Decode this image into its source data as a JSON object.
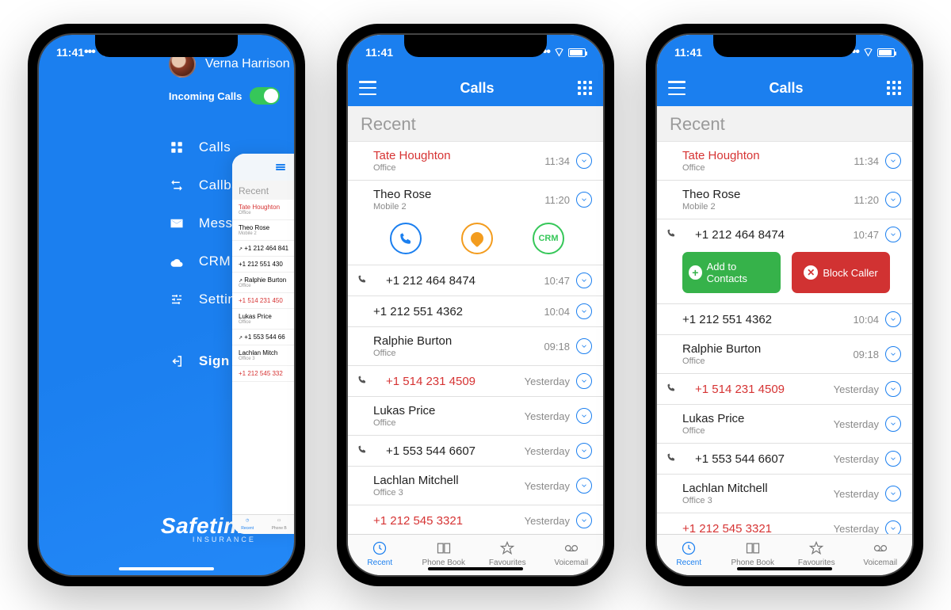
{
  "status": {
    "time": "11:41"
  },
  "screen1": {
    "user_name": "Verna Harrison",
    "incoming_label": "Incoming Calls",
    "menu": {
      "calls": "Calls",
      "callbacks": "Callbacks",
      "messages": "Messages",
      "crm": "CRM",
      "settings": "Settings",
      "signout": "Sign Out"
    },
    "brand": {
      "name": "Safetime",
      "sub": "INSURANCE"
    },
    "preview": {
      "section": "Recent",
      "items": [
        {
          "name": "Tate Houghton",
          "sub": "Office",
          "red": true
        },
        {
          "name": "Theo Rose",
          "sub": "Mobile 2"
        },
        {
          "name": "+1 212 464 841",
          "sub": "",
          "outgoing": true
        },
        {
          "name": "+1 212 551 430",
          "sub": ""
        },
        {
          "name": "Ralphie Burton",
          "sub": "Office",
          "outgoing": true
        },
        {
          "name": "+1 514 231 450",
          "sub": "",
          "red": true
        },
        {
          "name": "Lukas Price",
          "sub": "Office"
        },
        {
          "name": "+1 553 544 66",
          "sub": "",
          "outgoing": true
        },
        {
          "name": "Lachlan Mitch",
          "sub": "Office 3"
        },
        {
          "name": "+1 212 545 332",
          "sub": "",
          "red": true
        }
      ],
      "tabs": {
        "recent": "Recent",
        "phonebook": "Phone B"
      }
    }
  },
  "calls_header": {
    "title": "Calls"
  },
  "section_label": "Recent",
  "calls_list": [
    {
      "name": "Tate Houghton",
      "sub": "Office",
      "time": "11:34",
      "red": true
    },
    {
      "name": "Theo Rose",
      "sub": "Mobile 2",
      "time": "11:20"
    },
    {
      "name": "+1 212 464 8474",
      "time": "10:47",
      "outgoing": true
    },
    {
      "name": "+1 212 551 4362",
      "time": "10:04"
    },
    {
      "name": "Ralphie Burton",
      "sub": "Office",
      "time": "09:18"
    },
    {
      "name": "+1 514 231 4509",
      "time": "Yesterday",
      "red": true,
      "outgoing": true
    },
    {
      "name": "Lukas Price",
      "sub": "Office",
      "time": "Yesterday"
    },
    {
      "name": "+1 553 544 6607",
      "time": "Yesterday",
      "outgoing": true
    },
    {
      "name": "Lachlan Mitchell",
      "sub": "Office 3",
      "time": "Yesterday"
    },
    {
      "name": "+1 212 545 3321",
      "time": "Yesterday",
      "red": true
    }
  ],
  "expanded_actions": {
    "crm_label": "CRM"
  },
  "contact_actions": {
    "add": "Add to Contacts",
    "block": "Block Caller"
  },
  "tabs": {
    "recent": "Recent",
    "phonebook": "Phone Book",
    "favourites": "Favourites",
    "voicemail": "Voicemail"
  }
}
